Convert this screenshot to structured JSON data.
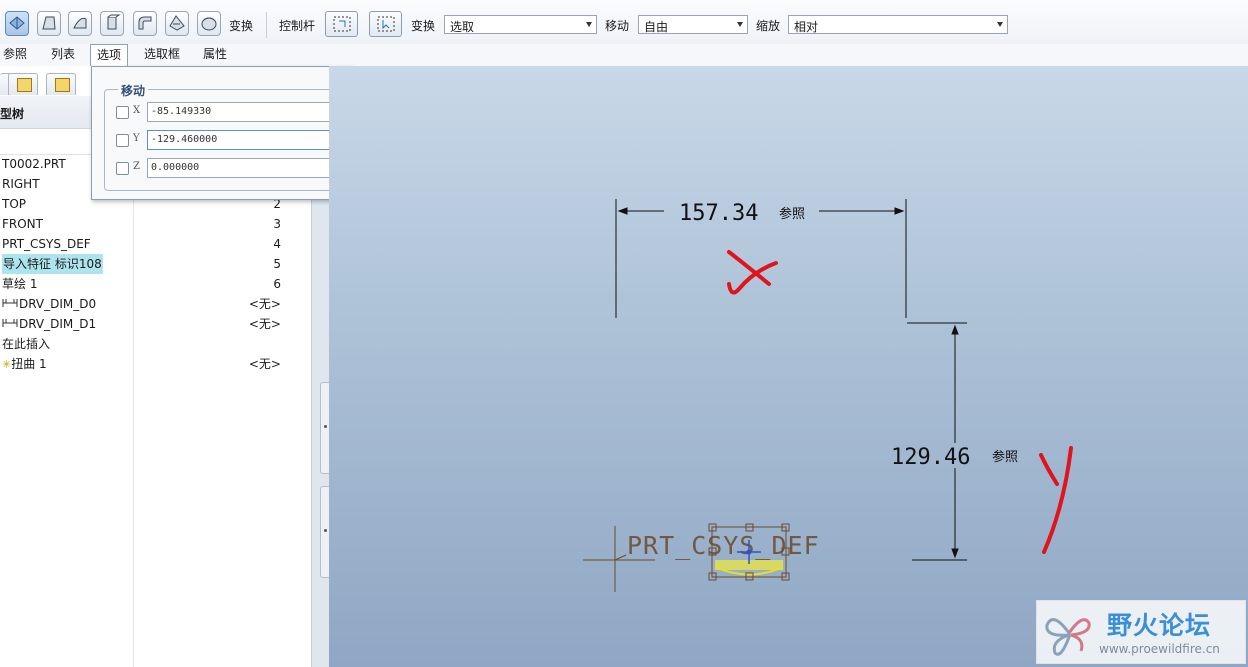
{
  "toolbar": {
    "transform_label": "变换",
    "dragger_label": "控制杆",
    "transform2_label": "变换",
    "transform_value": "选取",
    "move_label": "移动",
    "move_value": "自由",
    "scale_label": "缩放",
    "scale_value": "相对"
  },
  "tabs": [
    "参照",
    "列表",
    "选项",
    "选取框",
    "属性"
  ],
  "tree": {
    "header": "型树",
    "rows": [
      {
        "name": "T0002.PRT",
        "value": ""
      },
      {
        "name": "RIGHT",
        "value": ""
      },
      {
        "name": "TOP",
        "value": "2"
      },
      {
        "name": "FRONT",
        "value": "3"
      },
      {
        "name": "PRT_CSYS_DEF",
        "value": "4"
      },
      {
        "name": "导入特征 标识108",
        "value": "5"
      },
      {
        "name": "草绘 1",
        "value": "6"
      },
      {
        "name": "DRV_DIM_D0",
        "value": "<无>"
      },
      {
        "name": "DRV_DIM_D1",
        "value": "<无>"
      },
      {
        "name": "在此插入",
        "value": ""
      },
      {
        "name": "扭曲 1",
        "value": "<无>"
      }
    ]
  },
  "options_popup": {
    "group_label": "移动",
    "fields": [
      {
        "axis": "X",
        "value": "-85.149330"
      },
      {
        "axis": "Y",
        "value": "-129.460000"
      },
      {
        "axis": "Z",
        "value": "0.000000"
      }
    ]
  },
  "viewport": {
    "dim_horizontal": "157.34",
    "dim_vertical": "129.46",
    "ref_label": "参照",
    "csys_label": "PRT_CSYS_DEF",
    "annotation_x": "X",
    "annotation_y": "Y",
    "annotation_color": "#e0141c"
  },
  "watermark": {
    "title": "野火论坛",
    "url": "www.proewildfire.cn"
  }
}
